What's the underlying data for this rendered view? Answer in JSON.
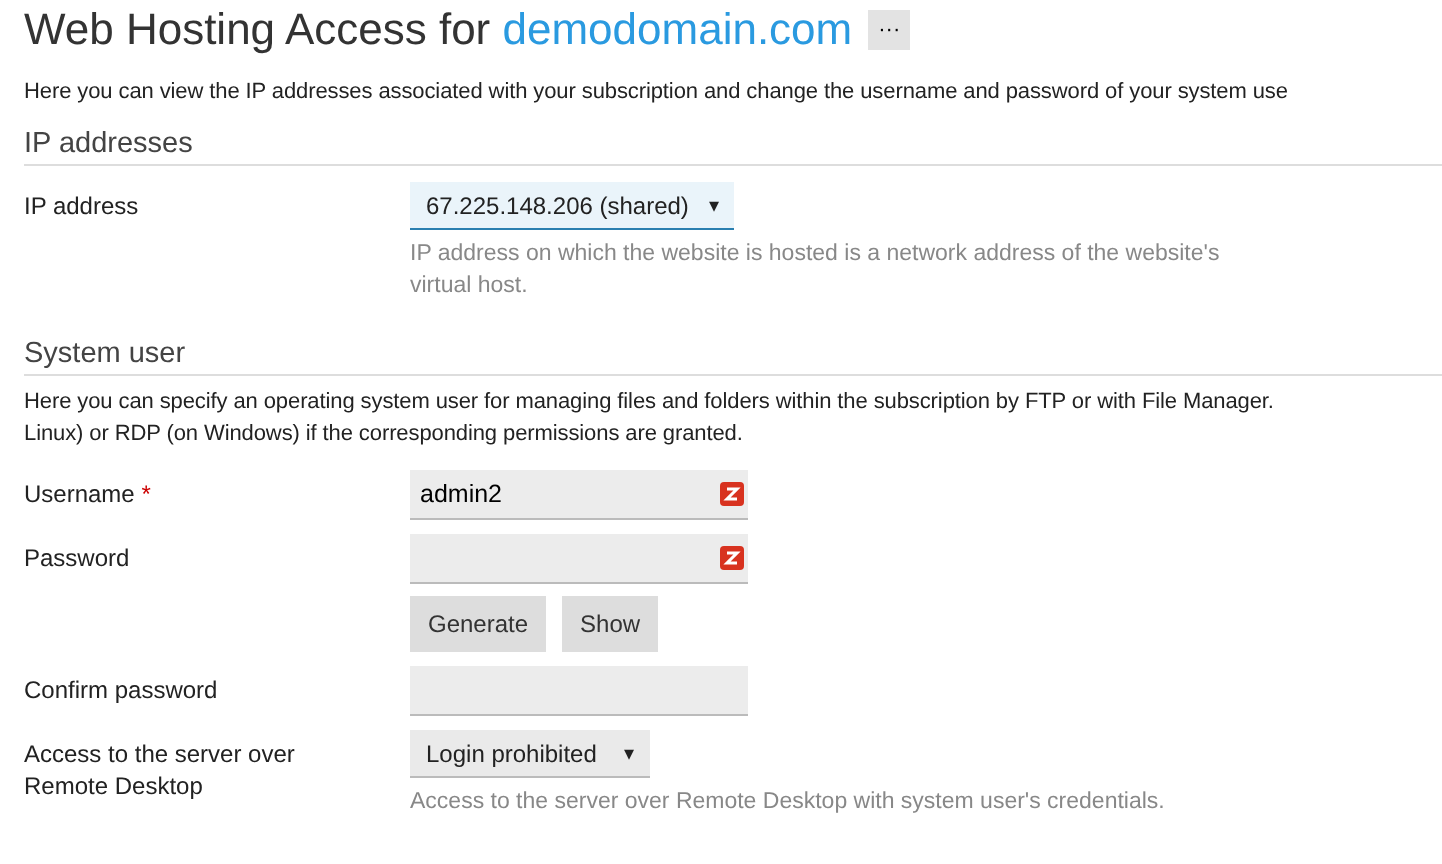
{
  "title": {
    "text": "Web Hosting Access for ",
    "domain": "demodomain.com",
    "more": "···"
  },
  "intro": "Here you can view the IP addresses associated with your subscription and change the username and password of your system use",
  "ip_section": {
    "heading": "IP addresses",
    "label": "IP address",
    "value": "67.225.148.206 (shared)",
    "caret": "▾",
    "hint_lines": [
      "IP address on which the website is hosted is a network address of the website's",
      "virtual host."
    ]
  },
  "user_section": {
    "heading": "System user",
    "description_lines": [
      "Here you can specify an operating system user for managing files and folders within the subscription by FTP or with File Manager.",
      "Linux) or RDP (on Windows) if the corresponding permissions are granted."
    ],
    "fields": [
      {
        "kind": "text",
        "label": "Username",
        "required_mark": "*",
        "value": "admin2",
        "badge": true
      },
      {
        "kind": "password",
        "label": "Password",
        "badge": true,
        "buttons": [
          "Generate",
          "Show"
        ]
      },
      {
        "kind": "password",
        "label": "Confirm password",
        "badge": false
      },
      {
        "kind": "select",
        "label_lines": [
          "Access to the server over",
          "Remote Desktop"
        ],
        "value": "Login prohibited",
        "caret": "▾",
        "hint": "Access to the server over Remote Desktop with system user's credentials."
      }
    ]
  }
}
